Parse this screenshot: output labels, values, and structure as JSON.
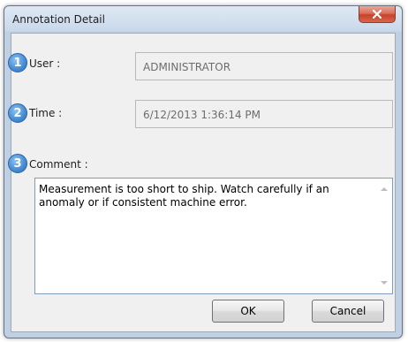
{
  "window": {
    "title": "Annotation Detail",
    "close_icon": "close-icon"
  },
  "badges": [
    "1",
    "2",
    "3"
  ],
  "user": {
    "label": "User  :",
    "value": "ADMINISTRATOR"
  },
  "time": {
    "label": "Time :",
    "value": "6/12/2013 1:36:14 PM"
  },
  "comment": {
    "label": "Comment :",
    "value": "Measurement is too short to ship. Watch carefully if an anomaly or if consistent machine error."
  },
  "buttons": {
    "ok": "OK",
    "cancel": "Cancel"
  },
  "colors": {
    "badge": "#4a90d6",
    "close_button": "#c7432a"
  }
}
